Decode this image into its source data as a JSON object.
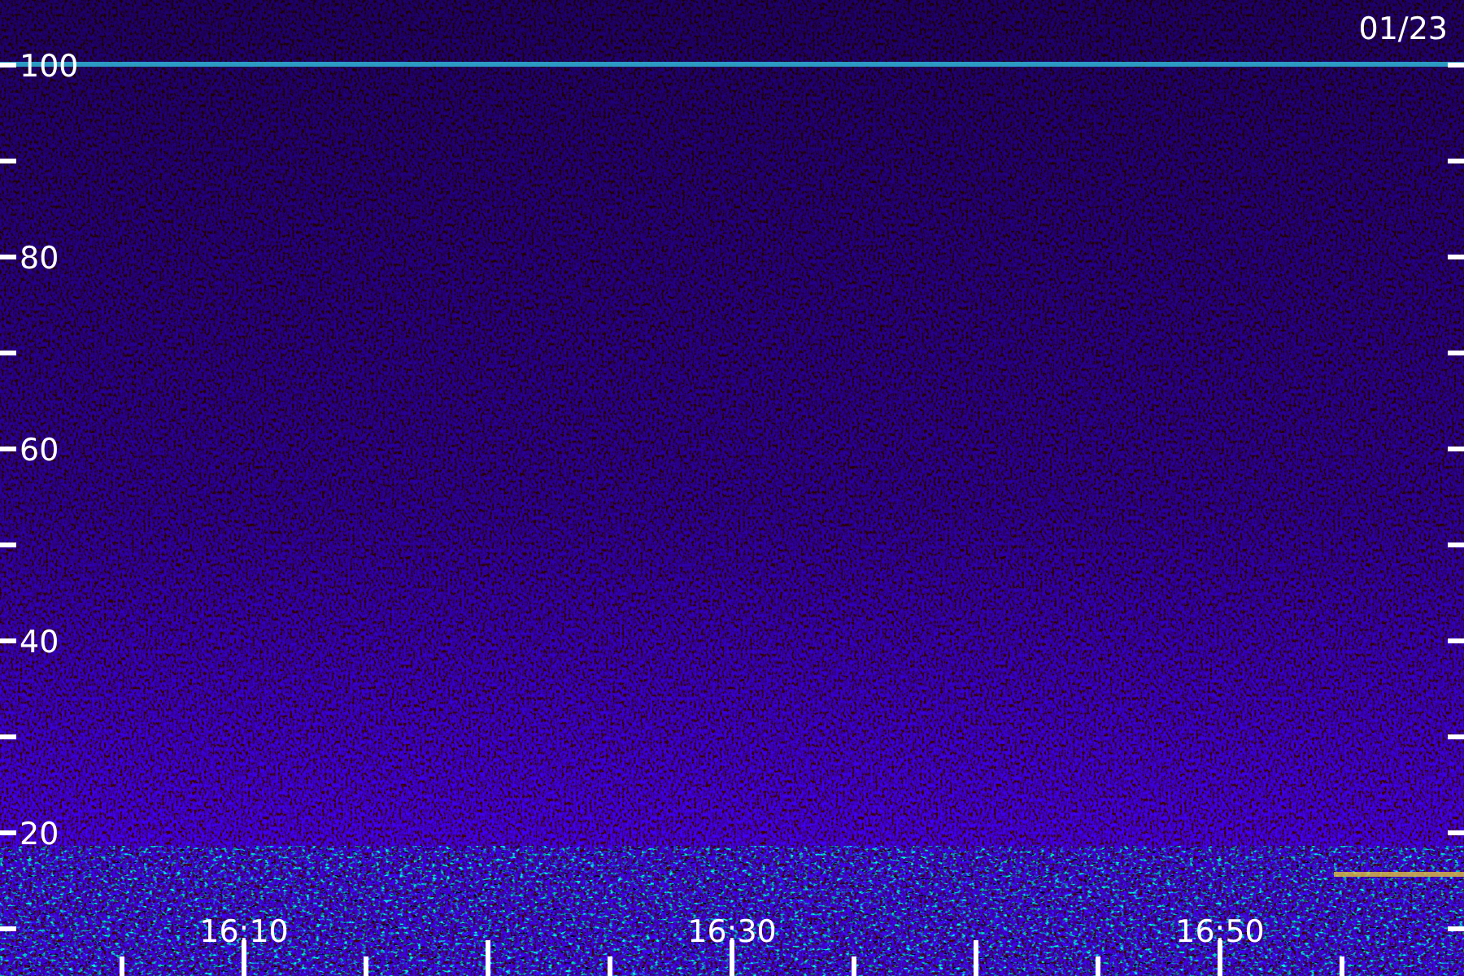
{
  "date_label": "01/23",
  "y_axis": {
    "labels": [
      "100",
      "80",
      "60",
      "40",
      "20"
    ]
  },
  "x_axis": {
    "labels": [
      "16:10",
      "16:30",
      "16:50"
    ]
  }
}
